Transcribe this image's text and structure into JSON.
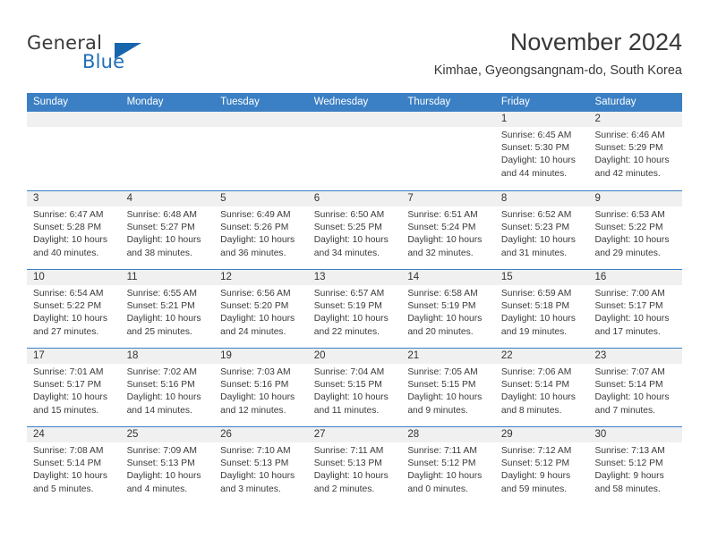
{
  "logo": {
    "word_one": "General",
    "word_two": "Blue",
    "mark": "triangle-icon"
  },
  "header": {
    "title": "November 2024",
    "location": "Kimhae, Gyeongsangnam-do, South Korea"
  },
  "calendar": {
    "weekday_headers": [
      "Sunday",
      "Monday",
      "Tuesday",
      "Wednesday",
      "Thursday",
      "Friday",
      "Saturday"
    ],
    "colors": {
      "header_background": "#3b7fc4",
      "header_text": "#ffffff",
      "date_band": "#f0f0f0",
      "row_divider": "#3b7fc4",
      "body_text": "#3a3a3a"
    },
    "weeks": [
      [
        {
          "blank": true
        },
        {
          "blank": true
        },
        {
          "blank": true
        },
        {
          "blank": true
        },
        {
          "blank": true
        },
        {
          "date": "1",
          "sunrise": "Sunrise: 6:45 AM",
          "sunset": "Sunset: 5:30 PM",
          "daylight": "Daylight: 10 hours and 44 minutes."
        },
        {
          "date": "2",
          "sunrise": "Sunrise: 6:46 AM",
          "sunset": "Sunset: 5:29 PM",
          "daylight": "Daylight: 10 hours and 42 minutes."
        }
      ],
      [
        {
          "date": "3",
          "sunrise": "Sunrise: 6:47 AM",
          "sunset": "Sunset: 5:28 PM",
          "daylight": "Daylight: 10 hours and 40 minutes."
        },
        {
          "date": "4",
          "sunrise": "Sunrise: 6:48 AM",
          "sunset": "Sunset: 5:27 PM",
          "daylight": "Daylight: 10 hours and 38 minutes."
        },
        {
          "date": "5",
          "sunrise": "Sunrise: 6:49 AM",
          "sunset": "Sunset: 5:26 PM",
          "daylight": "Daylight: 10 hours and 36 minutes."
        },
        {
          "date": "6",
          "sunrise": "Sunrise: 6:50 AM",
          "sunset": "Sunset: 5:25 PM",
          "daylight": "Daylight: 10 hours and 34 minutes."
        },
        {
          "date": "7",
          "sunrise": "Sunrise: 6:51 AM",
          "sunset": "Sunset: 5:24 PM",
          "daylight": "Daylight: 10 hours and 32 minutes."
        },
        {
          "date": "8",
          "sunrise": "Sunrise: 6:52 AM",
          "sunset": "Sunset: 5:23 PM",
          "daylight": "Daylight: 10 hours and 31 minutes."
        },
        {
          "date": "9",
          "sunrise": "Sunrise: 6:53 AM",
          "sunset": "Sunset: 5:22 PM",
          "daylight": "Daylight: 10 hours and 29 minutes."
        }
      ],
      [
        {
          "date": "10",
          "sunrise": "Sunrise: 6:54 AM",
          "sunset": "Sunset: 5:22 PM",
          "daylight": "Daylight: 10 hours and 27 minutes."
        },
        {
          "date": "11",
          "sunrise": "Sunrise: 6:55 AM",
          "sunset": "Sunset: 5:21 PM",
          "daylight": "Daylight: 10 hours and 25 minutes."
        },
        {
          "date": "12",
          "sunrise": "Sunrise: 6:56 AM",
          "sunset": "Sunset: 5:20 PM",
          "daylight": "Daylight: 10 hours and 24 minutes."
        },
        {
          "date": "13",
          "sunrise": "Sunrise: 6:57 AM",
          "sunset": "Sunset: 5:19 PM",
          "daylight": "Daylight: 10 hours and 22 minutes."
        },
        {
          "date": "14",
          "sunrise": "Sunrise: 6:58 AM",
          "sunset": "Sunset: 5:19 PM",
          "daylight": "Daylight: 10 hours and 20 minutes."
        },
        {
          "date": "15",
          "sunrise": "Sunrise: 6:59 AM",
          "sunset": "Sunset: 5:18 PM",
          "daylight": "Daylight: 10 hours and 19 minutes."
        },
        {
          "date": "16",
          "sunrise": "Sunrise: 7:00 AM",
          "sunset": "Sunset: 5:17 PM",
          "daylight": "Daylight: 10 hours and 17 minutes."
        }
      ],
      [
        {
          "date": "17",
          "sunrise": "Sunrise: 7:01 AM",
          "sunset": "Sunset: 5:17 PM",
          "daylight": "Daylight: 10 hours and 15 minutes."
        },
        {
          "date": "18",
          "sunrise": "Sunrise: 7:02 AM",
          "sunset": "Sunset: 5:16 PM",
          "daylight": "Daylight: 10 hours and 14 minutes."
        },
        {
          "date": "19",
          "sunrise": "Sunrise: 7:03 AM",
          "sunset": "Sunset: 5:16 PM",
          "daylight": "Daylight: 10 hours and 12 minutes."
        },
        {
          "date": "20",
          "sunrise": "Sunrise: 7:04 AM",
          "sunset": "Sunset: 5:15 PM",
          "daylight": "Daylight: 10 hours and 11 minutes."
        },
        {
          "date": "21",
          "sunrise": "Sunrise: 7:05 AM",
          "sunset": "Sunset: 5:15 PM",
          "daylight": "Daylight: 10 hours and 9 minutes."
        },
        {
          "date": "22",
          "sunrise": "Sunrise: 7:06 AM",
          "sunset": "Sunset: 5:14 PM",
          "daylight": "Daylight: 10 hours and 8 minutes."
        },
        {
          "date": "23",
          "sunrise": "Sunrise: 7:07 AM",
          "sunset": "Sunset: 5:14 PM",
          "daylight": "Daylight: 10 hours and 7 minutes."
        }
      ],
      [
        {
          "date": "24",
          "sunrise": "Sunrise: 7:08 AM",
          "sunset": "Sunset: 5:14 PM",
          "daylight": "Daylight: 10 hours and 5 minutes."
        },
        {
          "date": "25",
          "sunrise": "Sunrise: 7:09 AM",
          "sunset": "Sunset: 5:13 PM",
          "daylight": "Daylight: 10 hours and 4 minutes."
        },
        {
          "date": "26",
          "sunrise": "Sunrise: 7:10 AM",
          "sunset": "Sunset: 5:13 PM",
          "daylight": "Daylight: 10 hours and 3 minutes."
        },
        {
          "date": "27",
          "sunrise": "Sunrise: 7:11 AM",
          "sunset": "Sunset: 5:13 PM",
          "daylight": "Daylight: 10 hours and 2 minutes."
        },
        {
          "date": "28",
          "sunrise": "Sunrise: 7:11 AM",
          "sunset": "Sunset: 5:12 PM",
          "daylight": "Daylight: 10 hours and 0 minutes."
        },
        {
          "date": "29",
          "sunrise": "Sunrise: 7:12 AM",
          "sunset": "Sunset: 5:12 PM",
          "daylight": "Daylight: 9 hours and 59 minutes."
        },
        {
          "date": "30",
          "sunrise": "Sunrise: 7:13 AM",
          "sunset": "Sunset: 5:12 PM",
          "daylight": "Daylight: 9 hours and 58 minutes."
        }
      ]
    ]
  }
}
